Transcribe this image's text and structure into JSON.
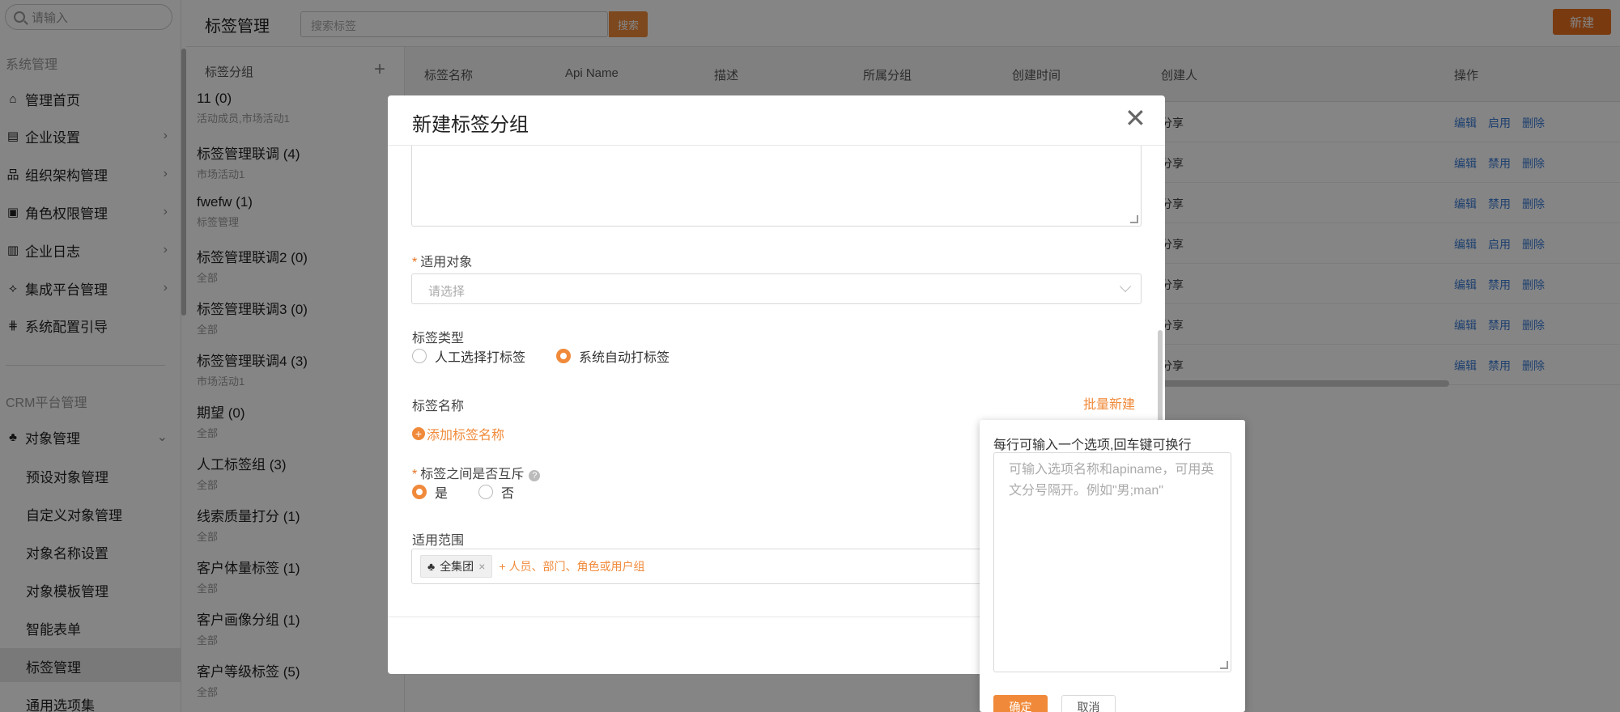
{
  "sidebar": {
    "search_placeholder": "请输入",
    "section_system": "系统管理",
    "items": [
      {
        "label": "管理首页",
        "icon": "home-icon",
        "glyph": "⌂"
      },
      {
        "label": "企业设置",
        "icon": "company-icon",
        "glyph": "▤"
      },
      {
        "label": "组织架构管理",
        "icon": "org-icon",
        "glyph": "品"
      },
      {
        "label": "角色权限管理",
        "icon": "role-icon",
        "glyph": "▣"
      },
      {
        "label": "企业日志",
        "icon": "log-icon",
        "glyph": "▥"
      },
      {
        "label": "集成平台管理",
        "icon": "integration-icon",
        "glyph": "⟡"
      },
      {
        "label": "系统配置引导",
        "icon": "config-icon",
        "glyph": "⋕"
      }
    ],
    "section_crm": "CRM平台管理",
    "object_mgmt": {
      "label": "对象管理",
      "icon": "object-icon",
      "glyph": "♣"
    },
    "sub_items": [
      "预设对象管理",
      "自定义对象管理",
      "对象名称设置",
      "对象模板管理",
      "智能表单",
      "标签管理",
      "通用选项集"
    ],
    "active_sub": "标签管理"
  },
  "topbar": {
    "title": "标签管理",
    "search_placeholder": "搜索标签",
    "search_button": "搜索",
    "new_button": "新建"
  },
  "group_panel": {
    "header": "标签分组",
    "groups": [
      {
        "name": "11 (0)",
        "sub": "活动成员,市场活动1"
      },
      {
        "name": "标签管理联调 (4)",
        "sub": "市场活动1"
      },
      {
        "name": "fwefw (1)",
        "sub": "标签管理"
      },
      {
        "name": "标签管理联调2 (0)",
        "sub": "全部"
      },
      {
        "name": "标签管理联调3 (0)",
        "sub": "全部"
      },
      {
        "name": "标签管理联调4 (3)",
        "sub": "市场活动1"
      },
      {
        "name": "期望 (0)",
        "sub": "全部"
      },
      {
        "name": "人工标签组 (3)",
        "sub": "全部"
      },
      {
        "name": "线索质量打分 (1)",
        "sub": "全部"
      },
      {
        "name": "客户体量标签 (1)",
        "sub": "全部"
      },
      {
        "name": "客户画像分组 (1)",
        "sub": "全部"
      },
      {
        "name": "客户等级标签 (5)",
        "sub": "全部"
      }
    ]
  },
  "table": {
    "columns": [
      "标签名称",
      "Api Name",
      "描述",
      "所属分组",
      "创建时间",
      "创建人",
      "操作"
    ],
    "rows": [
      {
        "creator": "分享",
        "ops": [
          "编辑",
          "启用",
          "删除"
        ]
      },
      {
        "creator": "分享",
        "ops": [
          "编辑",
          "禁用",
          "删除"
        ]
      },
      {
        "creator": "分享",
        "ops": [
          "编辑",
          "禁用",
          "删除"
        ]
      },
      {
        "creator": "分享",
        "ops": [
          "编辑",
          "启用",
          "删除"
        ]
      },
      {
        "creator": "分享",
        "ops": [
          "编辑",
          "禁用",
          "删除"
        ]
      },
      {
        "creator": "分享",
        "ops": [
          "编辑",
          "禁用",
          "删除"
        ]
      },
      {
        "creator": "分享",
        "ops": [
          "编辑",
          "禁用",
          "删除"
        ]
      }
    ]
  },
  "modal": {
    "title": "新建标签分组",
    "applicable_object_label": "适用对象",
    "applicable_object_placeholder": "请选择",
    "tag_type_label": "标签类型",
    "tag_type_options": [
      "人工选择打标签",
      "系统自动打标签"
    ],
    "tag_type_selected": "系统自动打标签",
    "tag_name_label": "标签名称",
    "batch_create": "批量新建",
    "add_tag_name": "添加标签名称",
    "mutex_label": "标签之间是否互斥",
    "mutex_options": [
      "是",
      "否"
    ],
    "mutex_selected": "是",
    "scope_label": "适用范围",
    "scope_tag": "全集团",
    "scope_add": "+ 人员、部门、角色或用户组"
  },
  "popover": {
    "label": "每行可输入一个选项,回车键可换行",
    "placeholder": "可输入选项名称和apiname，可用英文分号隔开。例如\"男;man\"",
    "ok": "确定",
    "cancel": "取消"
  }
}
